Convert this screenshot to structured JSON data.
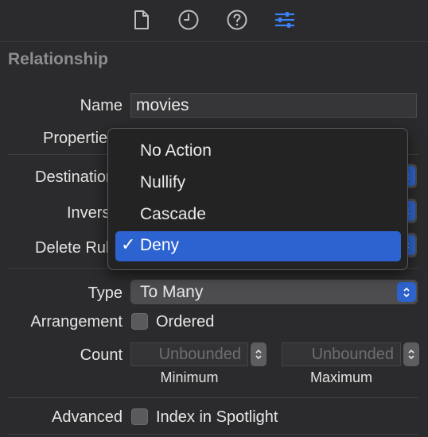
{
  "toolbar": {
    "icons": [
      "file-icon",
      "clock-icon",
      "help-icon",
      "sliders-icon"
    ],
    "accent": "#3b82f6"
  },
  "section": {
    "title": "Relationship"
  },
  "labels": {
    "name": "Name",
    "properties": "Properties",
    "destination": "Destination",
    "inverse": "Inverse",
    "delete_rule": "Delete Rule",
    "type": "Type",
    "arrangement": "Arrangement",
    "count": "Count",
    "advanced": "Advanced"
  },
  "fields": {
    "name_value": "movies",
    "type_value": "To Many",
    "ordered_label": "Ordered",
    "ordered_checked": false,
    "min_placeholder": "Unbounded",
    "max_placeholder": "Unbounded",
    "min_label": "Minimum",
    "max_label": "Maximum",
    "spotlight_label": "Index in Spotlight",
    "spotlight_checked": false
  },
  "menu": {
    "items": [
      "No Action",
      "Nullify",
      "Cascade",
      "Deny"
    ],
    "selected": "Deny",
    "check_glyph": "✓",
    "highlight": "#2d63d1"
  }
}
